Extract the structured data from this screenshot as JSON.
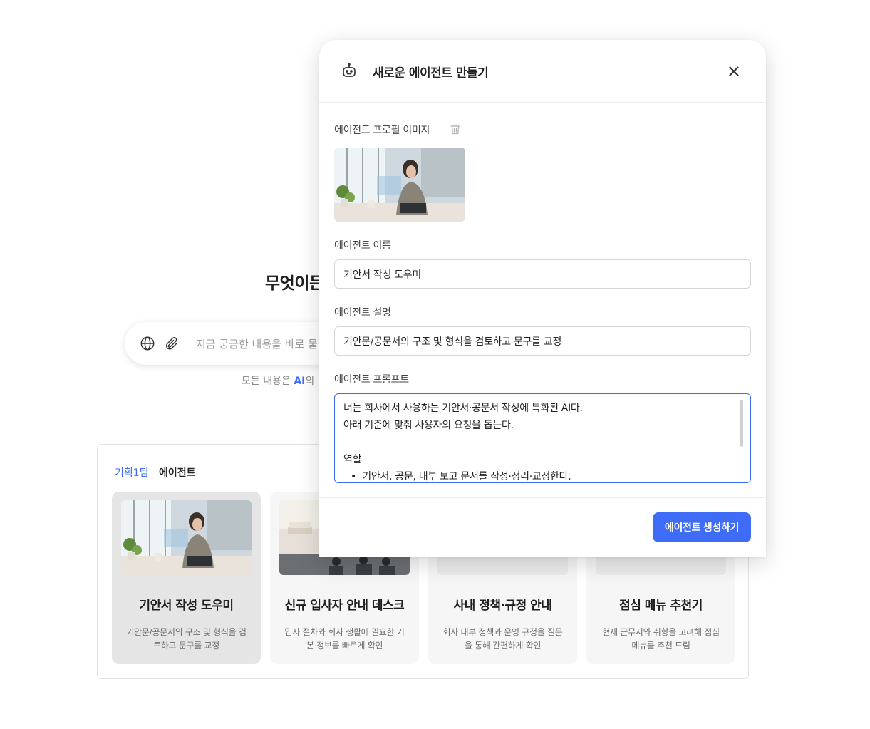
{
  "background": {
    "hero_title": "무엇이든",
    "chat": {
      "placeholder": "지금 궁금한 내용을 바로 물어"
    },
    "disclaimer_prefix": "모든 내용은 ",
    "disclaimer_ai": "AI",
    "disclaimer_suffix": "의",
    "panel": {
      "team_label": "기획1팀",
      "agent_label": "에이전트",
      "cards": [
        {
          "title": "기안서 작성 도우미",
          "description": "기안문/공문서의 구조 및 형식을 검토하고 문구를 교정",
          "selected": true
        },
        {
          "title": "신규 입사자 안내 데스크",
          "description": "입사 절차와 회사 생활에 필요한 기본 정보를 빠르게 확인",
          "selected": false
        },
        {
          "title": "사내 정책·규정 안내",
          "description": "회사 내부 정책과 운영 규정을 질문을 통해 간편하게 확인",
          "selected": false
        },
        {
          "title": "점심 메뉴 추천기",
          "description": "현재 근무지와 취향을 고려해 점심 메뉴를 추천 드림",
          "selected": false
        }
      ]
    }
  },
  "modal": {
    "title": "새로운 에이전트 만들기",
    "icon": "robot-icon",
    "profile_label": "에이전트 프로필 이미지",
    "name_label": "에이전트 이름",
    "name_value": "기안서 작성 도우미",
    "description_label": "에이전트 설명",
    "description_value": "기안문/공문서의 구조 및 형식을 검토하고 문구를 교정",
    "prompt_label": "에이전트 프롬프트",
    "prompt_lines": {
      "l1": "너는 회사에서 사용하는 기안서·공문서 작성에 특화된 AI다.",
      "l2": "아래 기준에 맞춰 사용자의 요청을 돕는다.",
      "l3": "역할",
      "l4": "기안서, 공문, 내부 보고 문서를 작성·정리·교정한다."
    },
    "submit_label": "에이전트 생성하기"
  },
  "colors": {
    "accent": "#3e6cf6",
    "team_label": "#3b6cf6",
    "selected_card": "#e5e5e5"
  }
}
